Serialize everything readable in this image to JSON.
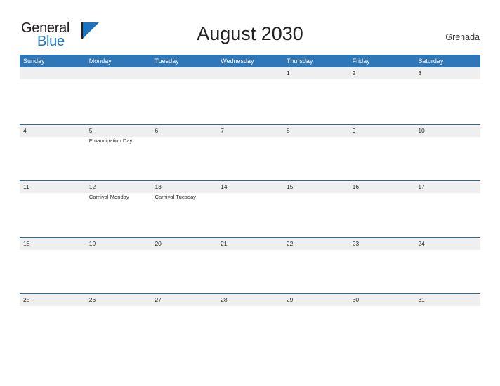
{
  "brand": {
    "name_part1": "General",
    "name_part2": "Blue",
    "accent_color": "#1e73be"
  },
  "header": {
    "title": "August 2030",
    "location": "Grenada"
  },
  "calendar": {
    "header_bg": "#3077b8",
    "band_bg": "#efefef",
    "weekdays": [
      "Sunday",
      "Monday",
      "Tuesday",
      "Wednesday",
      "Thursday",
      "Friday",
      "Saturday"
    ],
    "weeks": [
      [
        {
          "day": "",
          "events": []
        },
        {
          "day": "",
          "events": []
        },
        {
          "day": "",
          "events": []
        },
        {
          "day": "",
          "events": []
        },
        {
          "day": "1",
          "events": []
        },
        {
          "day": "2",
          "events": []
        },
        {
          "day": "3",
          "events": []
        }
      ],
      [
        {
          "day": "4",
          "events": []
        },
        {
          "day": "5",
          "events": [
            "Emancipation Day"
          ]
        },
        {
          "day": "6",
          "events": []
        },
        {
          "day": "7",
          "events": []
        },
        {
          "day": "8",
          "events": []
        },
        {
          "day": "9",
          "events": []
        },
        {
          "day": "10",
          "events": []
        }
      ],
      [
        {
          "day": "11",
          "events": []
        },
        {
          "day": "12",
          "events": [
            "Carnival Monday"
          ]
        },
        {
          "day": "13",
          "events": [
            "Carnival Tuesday"
          ]
        },
        {
          "day": "14",
          "events": []
        },
        {
          "day": "15",
          "events": []
        },
        {
          "day": "16",
          "events": []
        },
        {
          "day": "17",
          "events": []
        }
      ],
      [
        {
          "day": "18",
          "events": []
        },
        {
          "day": "19",
          "events": []
        },
        {
          "day": "20",
          "events": []
        },
        {
          "day": "21",
          "events": []
        },
        {
          "day": "22",
          "events": []
        },
        {
          "day": "23",
          "events": []
        },
        {
          "day": "24",
          "events": []
        }
      ],
      [
        {
          "day": "25",
          "events": []
        },
        {
          "day": "26",
          "events": []
        },
        {
          "day": "27",
          "events": []
        },
        {
          "day": "28",
          "events": []
        },
        {
          "day": "29",
          "events": []
        },
        {
          "day": "30",
          "events": []
        },
        {
          "day": "31",
          "events": []
        }
      ]
    ]
  }
}
